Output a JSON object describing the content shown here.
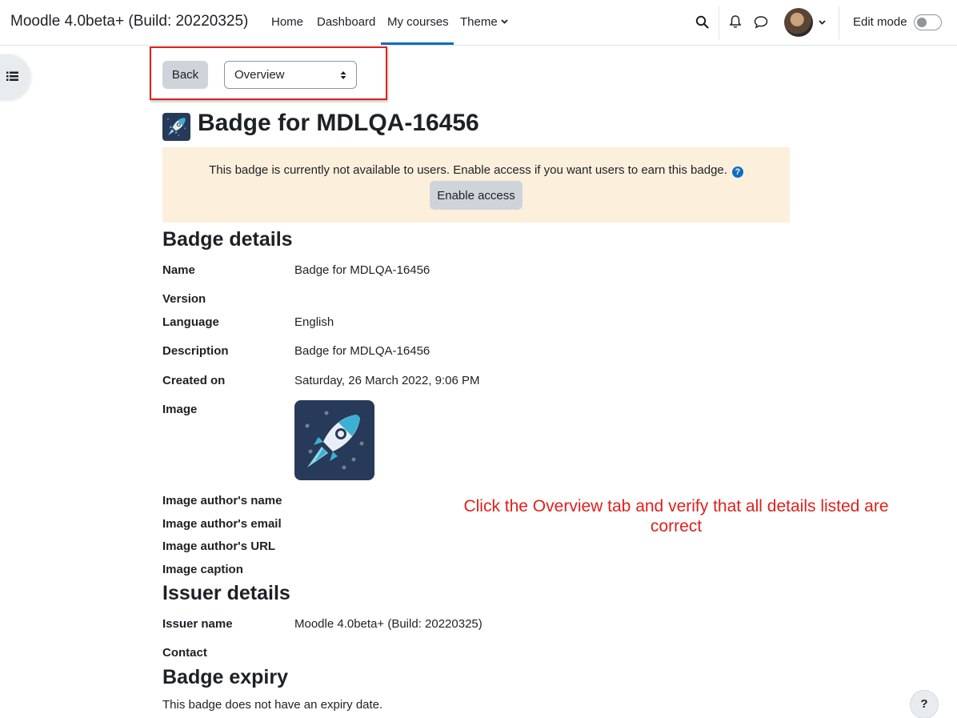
{
  "navbar": {
    "brand": "Moodle 4.0beta+ (Build: 20220325)",
    "items": [
      "Home",
      "Dashboard",
      "My courses",
      "Theme"
    ],
    "active_item": "My courses",
    "edit_mode_label": "Edit mode",
    "edit_mode_on": false,
    "accent_color": "#0f6cbf"
  },
  "actions": {
    "back_label": "Back",
    "view_select_value": "Overview"
  },
  "page_title": "Badge for MDLQA-16456",
  "alert": {
    "message": "This badge is currently not available to users. Enable access if you want users to earn this badge.",
    "button_label": "Enable access",
    "background": "#fcefdc"
  },
  "badge_details": {
    "heading": "Badge details",
    "rows": [
      {
        "label": "Name",
        "value": "Badge for MDLQA-16456"
      },
      {
        "label": "Version",
        "value": ""
      },
      {
        "label": "Language",
        "value": "English"
      },
      {
        "label": "Description",
        "value": "Badge for MDLQA-16456"
      },
      {
        "label": "Created on",
        "value": "Saturday, 26 March 2022, 9:06 PM"
      },
      {
        "label": "Image",
        "value": ""
      },
      {
        "label": "Image author's name",
        "value": ""
      },
      {
        "label": "Image author's email",
        "value": ""
      },
      {
        "label": "Image author's URL",
        "value": ""
      },
      {
        "label": "Image caption",
        "value": ""
      }
    ]
  },
  "issuer_details": {
    "heading": "Issuer details",
    "rows": [
      {
        "label": "Issuer name",
        "value": "Moodle 4.0beta+ (Build: 20220325)"
      },
      {
        "label": "Contact",
        "value": ""
      }
    ]
  },
  "badge_expiry": {
    "heading": "Badge expiry",
    "text": "This badge does not have an expiry date."
  },
  "annotation": "Click the Overview tab and verify that all details listed are correct",
  "help_button_label": "?",
  "icons": [
    "search-icon",
    "bell-icon",
    "chat-icon",
    "chevron-down-icon",
    "list-icon",
    "rocket-icon",
    "help-icon",
    "sort-arrows-icon"
  ]
}
